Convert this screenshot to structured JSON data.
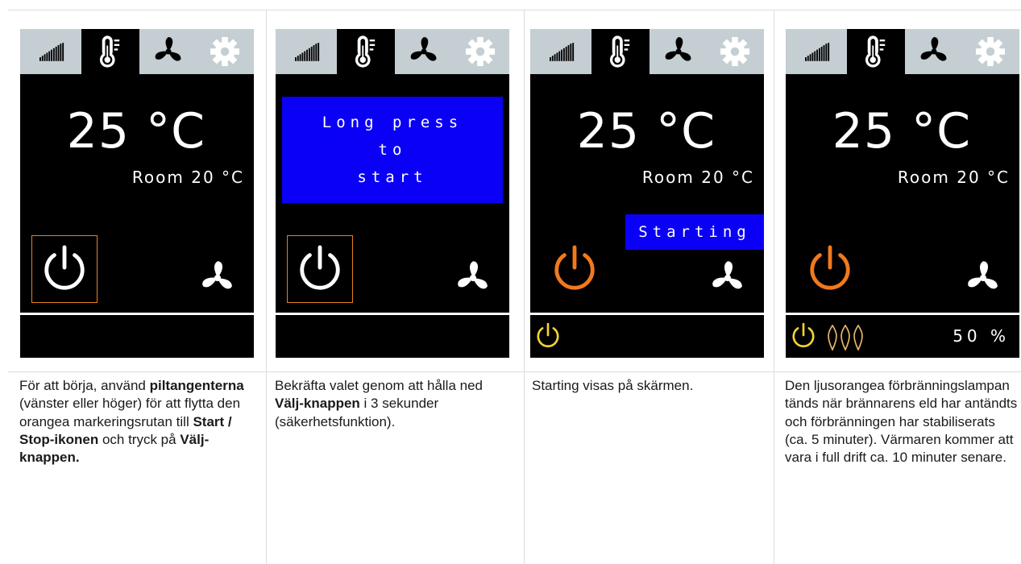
{
  "screens": [
    {
      "temperature": "25 °C",
      "room": "Room 20 °C"
    },
    {
      "message_lines": [
        "Long press",
        "to",
        "start"
      ]
    },
    {
      "temperature": "25 °C",
      "room": "Room 20 °C",
      "starting_label": "Starting"
    },
    {
      "temperature": "25 °C",
      "room": "Room 20 °C",
      "percent": "50 %"
    }
  ],
  "captions": [
    {
      "p1": "För att börja, använd ",
      "b1": "piltangenterna",
      "p2": " (vänster eller höger) för att flytta den orangea markeringsrutan till ",
      "b2": "Start / Stop-ikonen",
      "p3": " och tryck på ",
      "b3": "Välj-knappen."
    },
    {
      "p1": "Bekräfta valet genom att hålla ned ",
      "b1": "Välj-knappen",
      "p2": " i 3 sekunder (säkerhetsfunktion)."
    },
    {
      "p1": "Starting visas på skärmen."
    },
    {
      "p1": "Den ljusorangea förbränningslampan tänds när brännarens eld har antändts och förbränningen har stabiliserats (ca. 5 minuter). Värmaren kommer att vara i full drift ca. 10 minuter senare."
    }
  ],
  "colors": {
    "screen_bg": "#000000",
    "tab_bar": "#c5ced3",
    "selection_orange": "#e8801e",
    "power_orange": "#f07a1e",
    "status_yellow": "#f2d531",
    "flame_orange": "#e8b56a",
    "message_blue": "#0a00f5"
  },
  "icons": {
    "tabs": [
      "signal-bars-icon",
      "thermometer-icon",
      "fan-icon",
      "gear-icon"
    ],
    "controls": [
      "power-icon",
      "fan-icon"
    ],
    "status": [
      "power-icon",
      "flame-icon"
    ]
  }
}
